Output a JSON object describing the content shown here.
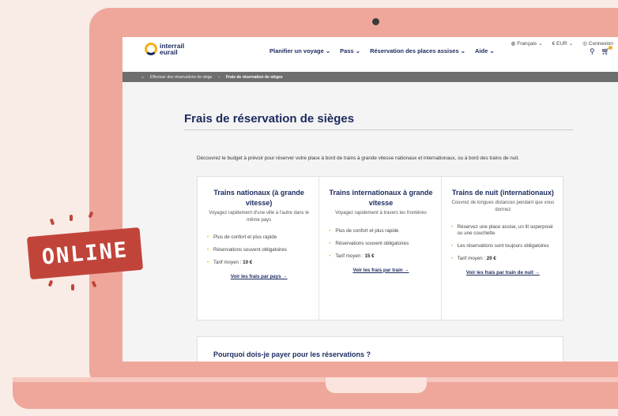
{
  "topbar": {
    "language": "Français",
    "currency": "€ EUR",
    "login": "Connexion"
  },
  "brand": {
    "line1": "interrail",
    "line2": "eurail"
  },
  "nav": [
    {
      "label": "Planifier un voyage"
    },
    {
      "label": "Pass"
    },
    {
      "label": "Réservation des places assises"
    },
    {
      "label": "Aide"
    }
  ],
  "icons": {
    "search": "search-icon",
    "cart": "cart-icon",
    "globe": "globe-icon",
    "user": "user-icon",
    "home": "home-icon"
  },
  "breadcrumb": {
    "parent": "Effectuer des réservations de siège",
    "current": "Frais de réservation de sièges"
  },
  "page": {
    "title": "Frais de réservation de sièges",
    "intro": "Découvrez le budget à prévoir pour réserver votre place à bord de trains à grande vitesse nationaux et internationaux, ou à bord des trains de nuit."
  },
  "cards": [
    {
      "title": "Trains nationaux (à grande vitesse)",
      "subtitle": "Voyagez rapidement d'une ville à l'autre dans le même pays",
      "bullets": [
        "Plus de confort et plus rapide",
        "Réservations souvent obligatoires"
      ],
      "price_label": "Tarif moyen : ",
      "price": "10 €",
      "link": "Voir les frais par pays →"
    },
    {
      "title": "Trains internationaux à grande vitesse",
      "subtitle": "Voyagez rapidement à travers les frontières",
      "bullets": [
        "Plus de confort et plus rapide",
        "Réservations souvent obligatoires"
      ],
      "price_label": "Tarif moyen : ",
      "price": "15 €",
      "link": "Voir les frais par train →"
    },
    {
      "title": "Trains de nuit (internationaux)",
      "subtitle": "Couvrez de longues distances pendant que vous dormez",
      "bullets": [
        "Réservez une place assise, un lit superposé ou une couchette",
        "Les réservations sont toujours obligatoires"
      ],
      "price_label": "Tarif moyen : ",
      "price": "20 €",
      "link": "Voir les frais par train de nuit →"
    }
  ],
  "faq": {
    "title": "Pourquoi dois-je payer pour les réservations ?"
  },
  "sticker": {
    "text": "ONLINE"
  },
  "colors": {
    "frame": "#efa79b",
    "sticker": "#c1443a",
    "brand": "#1b2a5e",
    "accent": "#f2b01e"
  }
}
